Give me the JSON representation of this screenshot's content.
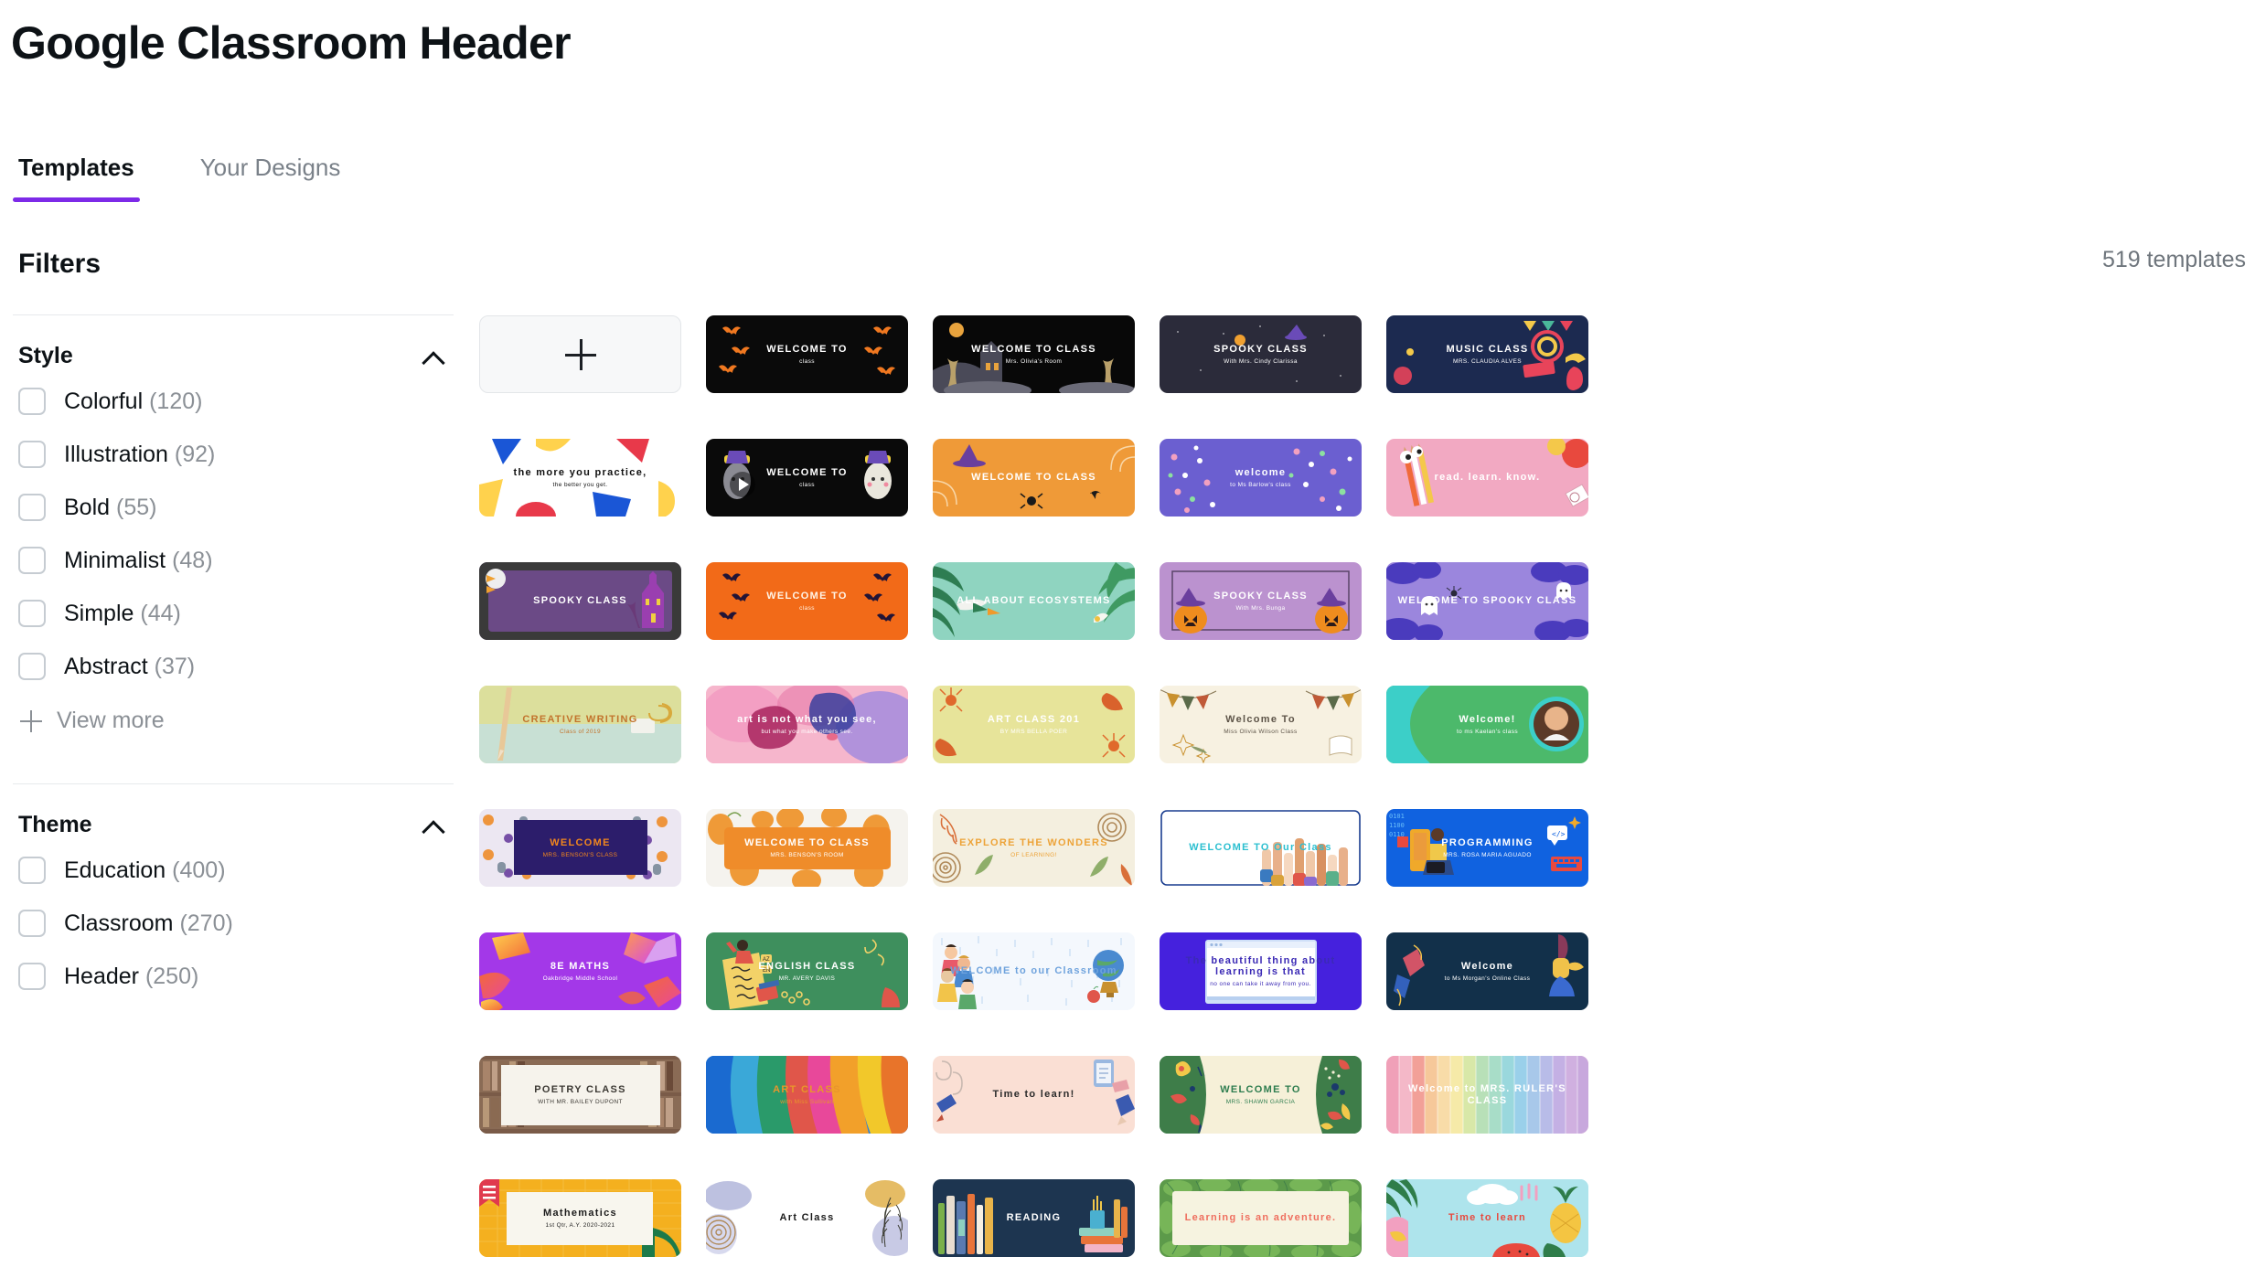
{
  "header": {
    "title": "Google Classroom Header"
  },
  "tabs": [
    {
      "label": "Templates",
      "active": true
    },
    {
      "label": "Your Designs",
      "active": false
    }
  ],
  "sidebar": {
    "title": "Filters",
    "groups": [
      {
        "title": "Style",
        "collapse_icon": "chevron-up-icon",
        "options": [
          {
            "label": "Colorful",
            "count": "(120)"
          },
          {
            "label": "Illustration",
            "count": "(92)"
          },
          {
            "label": "Bold",
            "count": "(55)"
          },
          {
            "label": "Minimalist",
            "count": "(48)"
          },
          {
            "label": "Simple",
            "count": "(44)"
          },
          {
            "label": "Abstract",
            "count": "(37)"
          }
        ],
        "view_more": "View more"
      },
      {
        "title": "Theme",
        "collapse_icon": "chevron-up-icon",
        "options": [
          {
            "label": "Education",
            "count": "(400)"
          },
          {
            "label": "Classroom",
            "count": "(270)"
          },
          {
            "label": "Header",
            "count": "(250)"
          }
        ]
      }
    ]
  },
  "results": {
    "count_label": "519 templates",
    "create_new_label": "+",
    "templates": [
      {
        "line1": "WELCOME TO",
        "line2": "class",
        "bg": "#0a0a0a",
        "fg": "#ffffff",
        "accent": "#f07820",
        "style": "bats-orange"
      },
      {
        "line1": "WELCOME TO CLASS",
        "line2": "Mrs. Olivia's Room",
        "bg": "#080808",
        "fg": "#ffffff",
        "accent": "#e8a33d",
        "style": "haunted-house"
      },
      {
        "line1": "SPOOKY CLASS",
        "line2": "With Mrs. Cindy Clarissa",
        "bg": "#2b2b3a",
        "fg": "#ffffff",
        "accent": "#f0a030",
        "style": "spooky-night"
      },
      {
        "line1": "MUSIC CLASS",
        "line2": "MRS. CLAUDIA ALVES",
        "bg": "#1c2a50",
        "fg": "#ffffff",
        "accent": "#e8445a",
        "style": "music"
      },
      {
        "line1": "the more you practice,",
        "line2": "the better you get.",
        "bg": "#ffffff",
        "fg": "#111111",
        "accent": "#1a56d6",
        "style": "confetti-shapes"
      },
      {
        "line1": "WELCOME TO",
        "line2": "class",
        "bg": "#0a0a0a",
        "fg": "#ffffff",
        "accent": "#6f5ba8",
        "style": "ghosts"
      },
      {
        "line1": "WELCOME TO CLASS",
        "line2": "",
        "bg": "#ef9a38",
        "fg": "#ffffff",
        "accent": "#6a3f9e",
        "style": "orange-witch"
      },
      {
        "line1": "welcome",
        "line2": "to Ms Barlow's class",
        "bg": "#6b5fd0",
        "fg": "#ffffff",
        "accent": "#7fe3a0",
        "style": "confetti-purple"
      },
      {
        "line1": "read. learn. know.",
        "line2": "",
        "bg": "#f2a9c2",
        "fg": "#ffffff",
        "accent": "#ffd84d",
        "style": "pink-pencils"
      },
      {
        "line1": "SPOOKY CLASS",
        "line2": "",
        "bg": "#6b4a86",
        "fg": "#ffffff",
        "accent": "#3a3a3a",
        "style": "purple-mansion"
      },
      {
        "line1": "WELCOME TO",
        "line2": "class",
        "bg": "#f26a18",
        "fg": "#fff4e6",
        "accent": "#221436",
        "style": "bats-black"
      },
      {
        "line1": "ALL ABOUT ECOSYSTEMS",
        "line2": "",
        "bg": "#8fd4c0",
        "fg": "#ffffff",
        "accent": "#2e7d52",
        "style": "tropical"
      },
      {
        "line1": "SPOOKY CLASS",
        "line2": "With Mrs. Bunga",
        "bg": "#bb92cf",
        "fg": "#ffffff",
        "accent": "#ef8c1e",
        "style": "pumpkins"
      },
      {
        "line1": "WELCOME TO SPOOKY CLASS",
        "line2": "",
        "bg": "#9b86dd",
        "fg": "#ffffff",
        "accent": "#4a3bbd",
        "style": "clouds-ghost"
      },
      {
        "line1": "CREATIVE WRITING",
        "line2": "Class of 2019",
        "bg": "#dcdf9c",
        "fg": "#c2732c",
        "accent": "#c8e0d4",
        "style": "pencil-desk"
      },
      {
        "line1": "art is not what you see,",
        "line2": "but what you make others see.",
        "bg": "#f3b9cf",
        "fg": "#ffffff",
        "accent": "#5a4bb0",
        "style": "watercolor"
      },
      {
        "line1": "ART CLASS 201",
        "line2": "BY MRS BELLA POER",
        "bg": "#e7e49a",
        "fg": "#ffffff",
        "accent": "#e0692c",
        "style": "autumn-leaves"
      },
      {
        "line1": "Welcome To",
        "line2": "Miss Olivia Wilson Class",
        "bg": "#f7f1e1",
        "fg": "#5d5448",
        "accent": "#c9912f",
        "style": "bunting"
      },
      {
        "line1": "Welcome!",
        "line2": "to ms Kaelan's class",
        "bg": "#4cb96b",
        "fg": "#ffffff",
        "accent": "#3ccfc8",
        "style": "green-photo"
      },
      {
        "line1": "WELCOME",
        "line2": "MRS. BENSON'S CLASS",
        "bg": "#ece7f2",
        "fg": "#f2871d",
        "accent": "#2c1d6b",
        "style": "halloween-pattern"
      },
      {
        "line1": "WELCOME TO CLASS",
        "line2": "MRS. BENSON'S ROOM",
        "bg": "#f5f3ee",
        "fg": "#ffffff",
        "accent": "#ef8c2a",
        "style": "pumpkin-patch"
      },
      {
        "line1": "EXPLORE THE WONDERS",
        "line2": "OF LEARNING!",
        "bg": "#f4efdf",
        "fg": "#eda338",
        "accent": "#d9703a",
        "style": "woodland"
      },
      {
        "line1": "WELCOME TO Our Class",
        "line2": "",
        "bg": "#ffffff",
        "fg": "#2bbfd0",
        "accent": "#1a3d8f",
        "style": "hands-up"
      },
      {
        "line1": "PROGRAMMING",
        "line2": "MRS. ROSA MARIA AGUADO",
        "bg": "#1062e0",
        "fg": "#ffffff",
        "accent": "#f0a92a",
        "style": "coding"
      },
      {
        "line1": "8E MATHS",
        "line2": "Oakbridge Middle School",
        "bg": "#a338e8",
        "fg": "#ffffff",
        "accent": "#ffd24d",
        "style": "gradient-shapes"
      },
      {
        "line1": "ENGLISH CLASS",
        "line2": "MR. AVERY DAVIS",
        "bg": "#3e8f5d",
        "fg": "#ffffff",
        "accent": "#f3d268",
        "style": "english-doodle"
      },
      {
        "line1": "WELCOME to our Classroom",
        "line2": "",
        "bg": "#f4f8fd",
        "fg": "#6fa3dd",
        "accent": "#2d5fa8",
        "style": "kids-globe"
      },
      {
        "line1": "The beautiful thing about learning is that",
        "line2": "no one can take it away from you.",
        "bg": "#4521dd",
        "fg": "#3b2ab5",
        "accent": "#ffffff",
        "style": "browser-quote"
      },
      {
        "line1": "Welcome",
        "line2": "to Ms Morgan's Online Class",
        "bg": "#12304a",
        "fg": "#ffffff",
        "accent": "#f0c24a",
        "style": "navy-hand"
      },
      {
        "line1": "POETRY CLASS",
        "line2": "WITH MR. BAILEY DUPONT",
        "bg": "#8a6b55",
        "fg": "#3d3a35",
        "accent": "#f6f3ec",
        "style": "bookshelf"
      },
      {
        "line1": "ART CLASS",
        "line2": "with Miss Sullivan",
        "bg": "#2f7fd8",
        "fg": "#e8962c",
        "accent": "#f2e14d",
        "style": "rainbow-paint"
      },
      {
        "line1": "Time to learn!",
        "line2": "",
        "bg": "#fadfd4",
        "fg": "#2b2b2b",
        "accent": "#c0503a",
        "style": "stationery-pink"
      },
      {
        "line1": "WELCOME TO",
        "line2": "MRS. SHAWN GARCIA",
        "bg": "#3e7d49",
        "fg": "#2e7d4f",
        "accent": "#f6f0d8",
        "style": "floral-green"
      },
      {
        "line1": "Welcome to MRS. RULER'S CLASS",
        "line2": "",
        "bg": "#f4a7b8",
        "fg": "#ffffff",
        "accent": "#8fd4e8",
        "style": "rainbow-stripes"
      },
      {
        "line1": "Mathematics",
        "line2": "1st Qtr, A.Y. 2020-2021",
        "bg": "#f4b01f",
        "fg": "#1b1b1b",
        "accent": "#e03a4e",
        "style": "yellow-notebook"
      },
      {
        "line1": "Art Class",
        "line2": "",
        "bg": "#ffffff",
        "fg": "#1b1b1b",
        "accent": "#9a9fd0",
        "style": "watercolor-white"
      },
      {
        "line1": "READING",
        "line2": "",
        "bg": "#1d3550",
        "fg": "#ffffff",
        "accent": "#e8743a",
        "style": "books-navy"
      },
      {
        "line1": "Learning is an adventure.",
        "line2": "",
        "bg": "#f6f3e0",
        "fg": "#ef6e5e",
        "accent": "#5c9a4a",
        "style": "leafy-border"
      },
      {
        "line1": "Time to learn",
        "line2": "",
        "bg": "#aee4ec",
        "fg": "#e8493e",
        "accent": "#f4c542",
        "style": "tropical-fruit"
      }
    ]
  },
  "theme": {
    "accent": "#7d2ae8",
    "text": "#0d1216",
    "muted": "#8b9096"
  }
}
